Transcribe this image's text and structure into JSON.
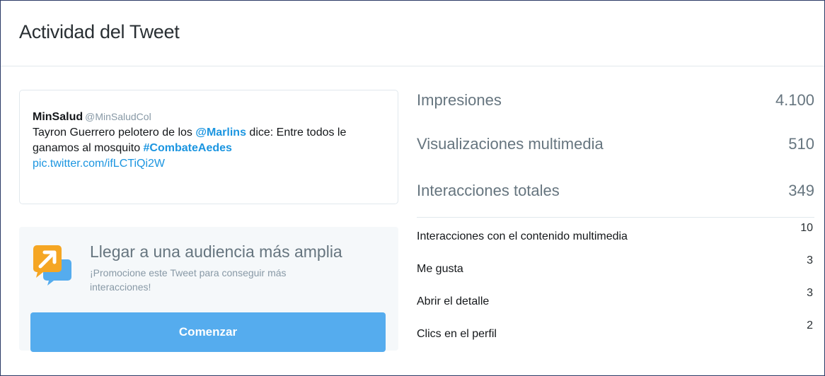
{
  "header": {
    "title": "Actividad del Tweet"
  },
  "tweet": {
    "name": "MinSalud",
    "handle": "@MinSaludCol",
    "text_1": "Tayron Guerrero pelotero de los ",
    "mention": "@Marlins",
    "text_2": " dice: Entre todos le ganamos al mosquito ",
    "hashtag": "#CombateAedes",
    "link": "pic.twitter.com/ifLCTiQi2W"
  },
  "promo": {
    "icon": "promote-arrow-icon",
    "title": "Llegar a una audiencia más amplia",
    "subtitle": "¡Promocione este Tweet para conseguir más interacciones!",
    "button_label": "Comenzar"
  },
  "metrics": {
    "main": [
      {
        "label": "Impresiones",
        "value": "4.100"
      },
      {
        "label": "Visualizaciones multimedia",
        "value": "510"
      },
      {
        "label": "Interacciones totales",
        "value": "349"
      }
    ],
    "breakdown": [
      {
        "label": "Interacciones con el contenido multimedia",
        "value": "10"
      },
      {
        "label": "Me gusta",
        "value": "3"
      },
      {
        "label": "Abrir el detalle",
        "value": "3"
      },
      {
        "label": "Clics en el perfil",
        "value": "2"
      }
    ]
  },
  "colors": {
    "accent": "#55acee",
    "link": "#1b95e0",
    "icon_orange": "#f5a623",
    "icon_blue": "#55acee"
  }
}
